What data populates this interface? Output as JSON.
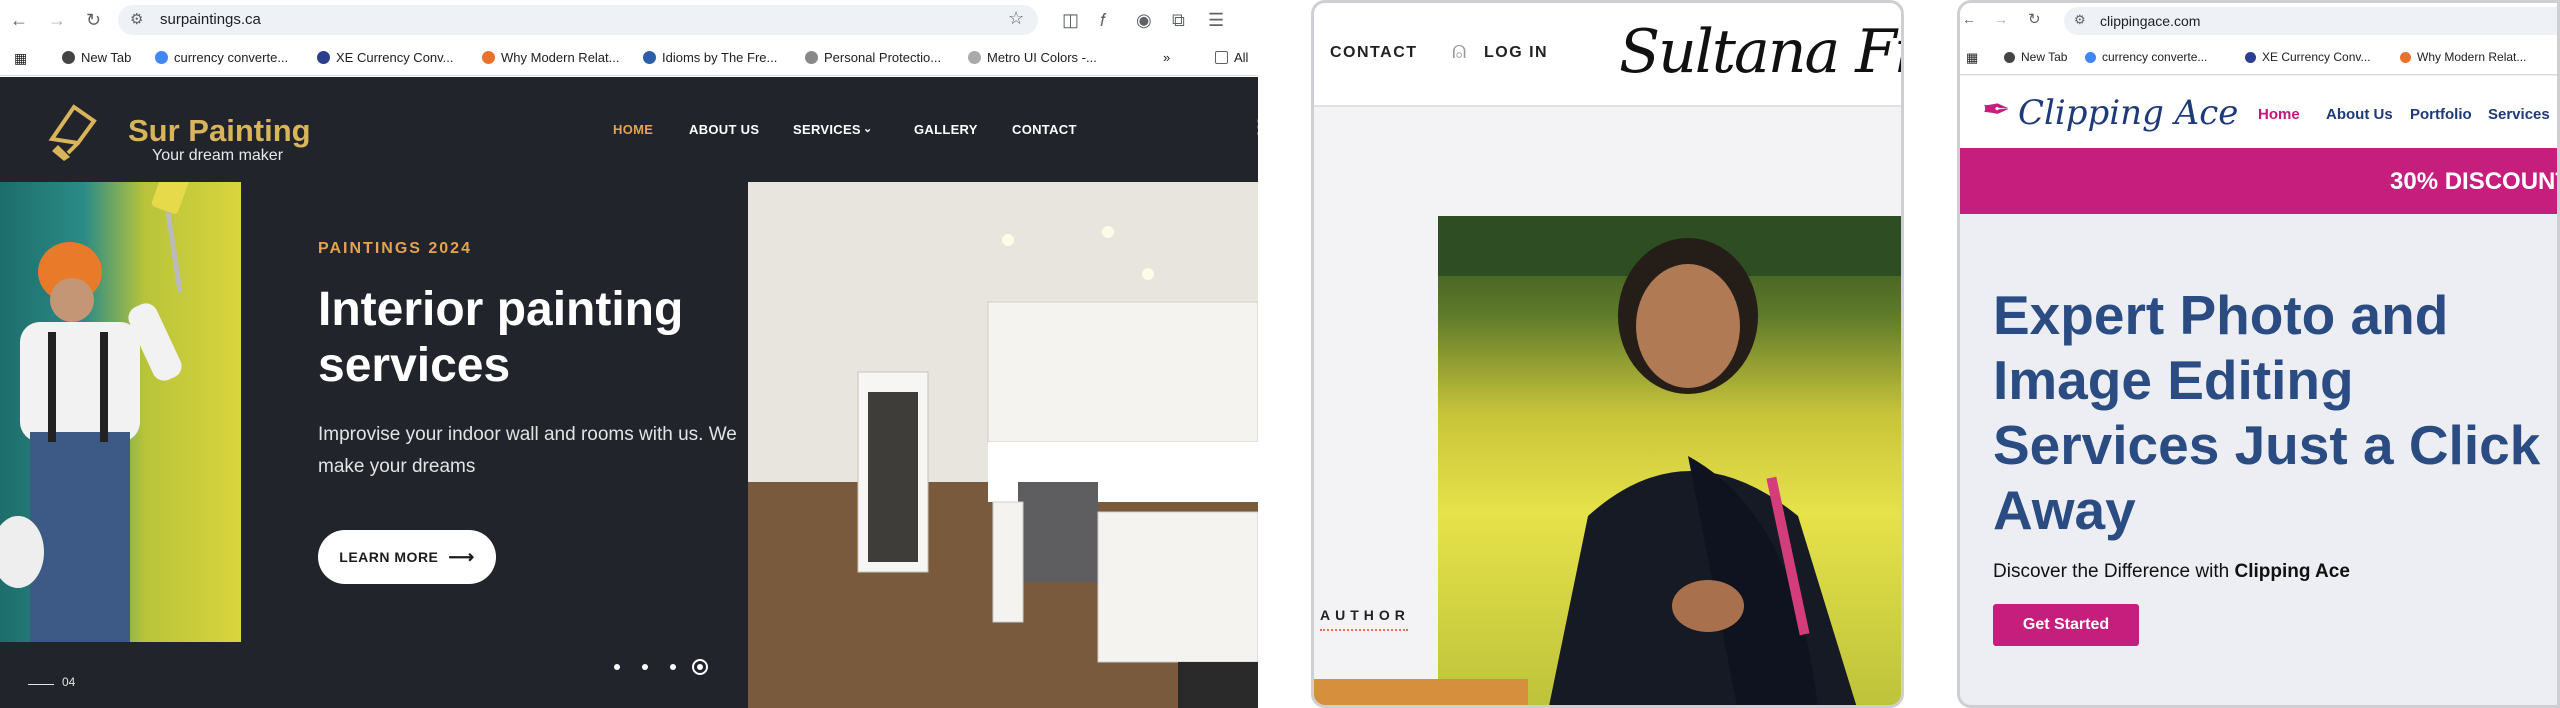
{
  "panel1": {
    "browser": {
      "url": "surpaintings.ca",
      "bookmarks": [
        "New Tab",
        "currency converte...",
        "XE Currency Conv...",
        "Why Modern Relat...",
        "Idioms by The Fre...",
        "Personal Protectio...",
        "Metro UI Colors -...",
        "All"
      ]
    },
    "site": {
      "brand": "Sur Painting",
      "tagline": "Your dream maker",
      "nav": [
        "HOME",
        "ABOUT US",
        "SERVICES",
        "GALLERY",
        "CONTACT"
      ],
      "kicker": "PAINTINGS 2024",
      "headline": "Interior painting services",
      "subtext": "Improvise your indoor wall and rooms with us. We make your dreams",
      "cta": "LEARN MORE",
      "slide_counter": "04"
    },
    "colors": {
      "bg": "#22242b",
      "accent": "#e5a24f",
      "brand": "#d8b45b"
    }
  },
  "panel2": {
    "nav": {
      "contact": "CONTACT",
      "login": "LOG IN"
    },
    "signature": "Sultana Firdousi",
    "author_label": "AUTHOR",
    "colors": {
      "accent": "#d58f3d"
    }
  },
  "panel3": {
    "browser": {
      "url": "clippingace.com",
      "bookmarks": [
        "New Tab",
        "currency converte...",
        "XE Currency Conv...",
        "Why Modern Relat..."
      ]
    },
    "site": {
      "brand": "Clipping Ace",
      "nav": [
        "Home",
        "About Us",
        "Portfolio",
        "Services"
      ],
      "promo": "30% DISCOUNT",
      "headline": "Expert Photo and Image Editing Services Just a Click Away",
      "sub_prefix": "Discover the Difference with ",
      "sub_brand": "Clipping Ace",
      "cta": "Get Started"
    },
    "colors": {
      "primary": "#2a4c82",
      "accent": "#c51e7d"
    }
  }
}
